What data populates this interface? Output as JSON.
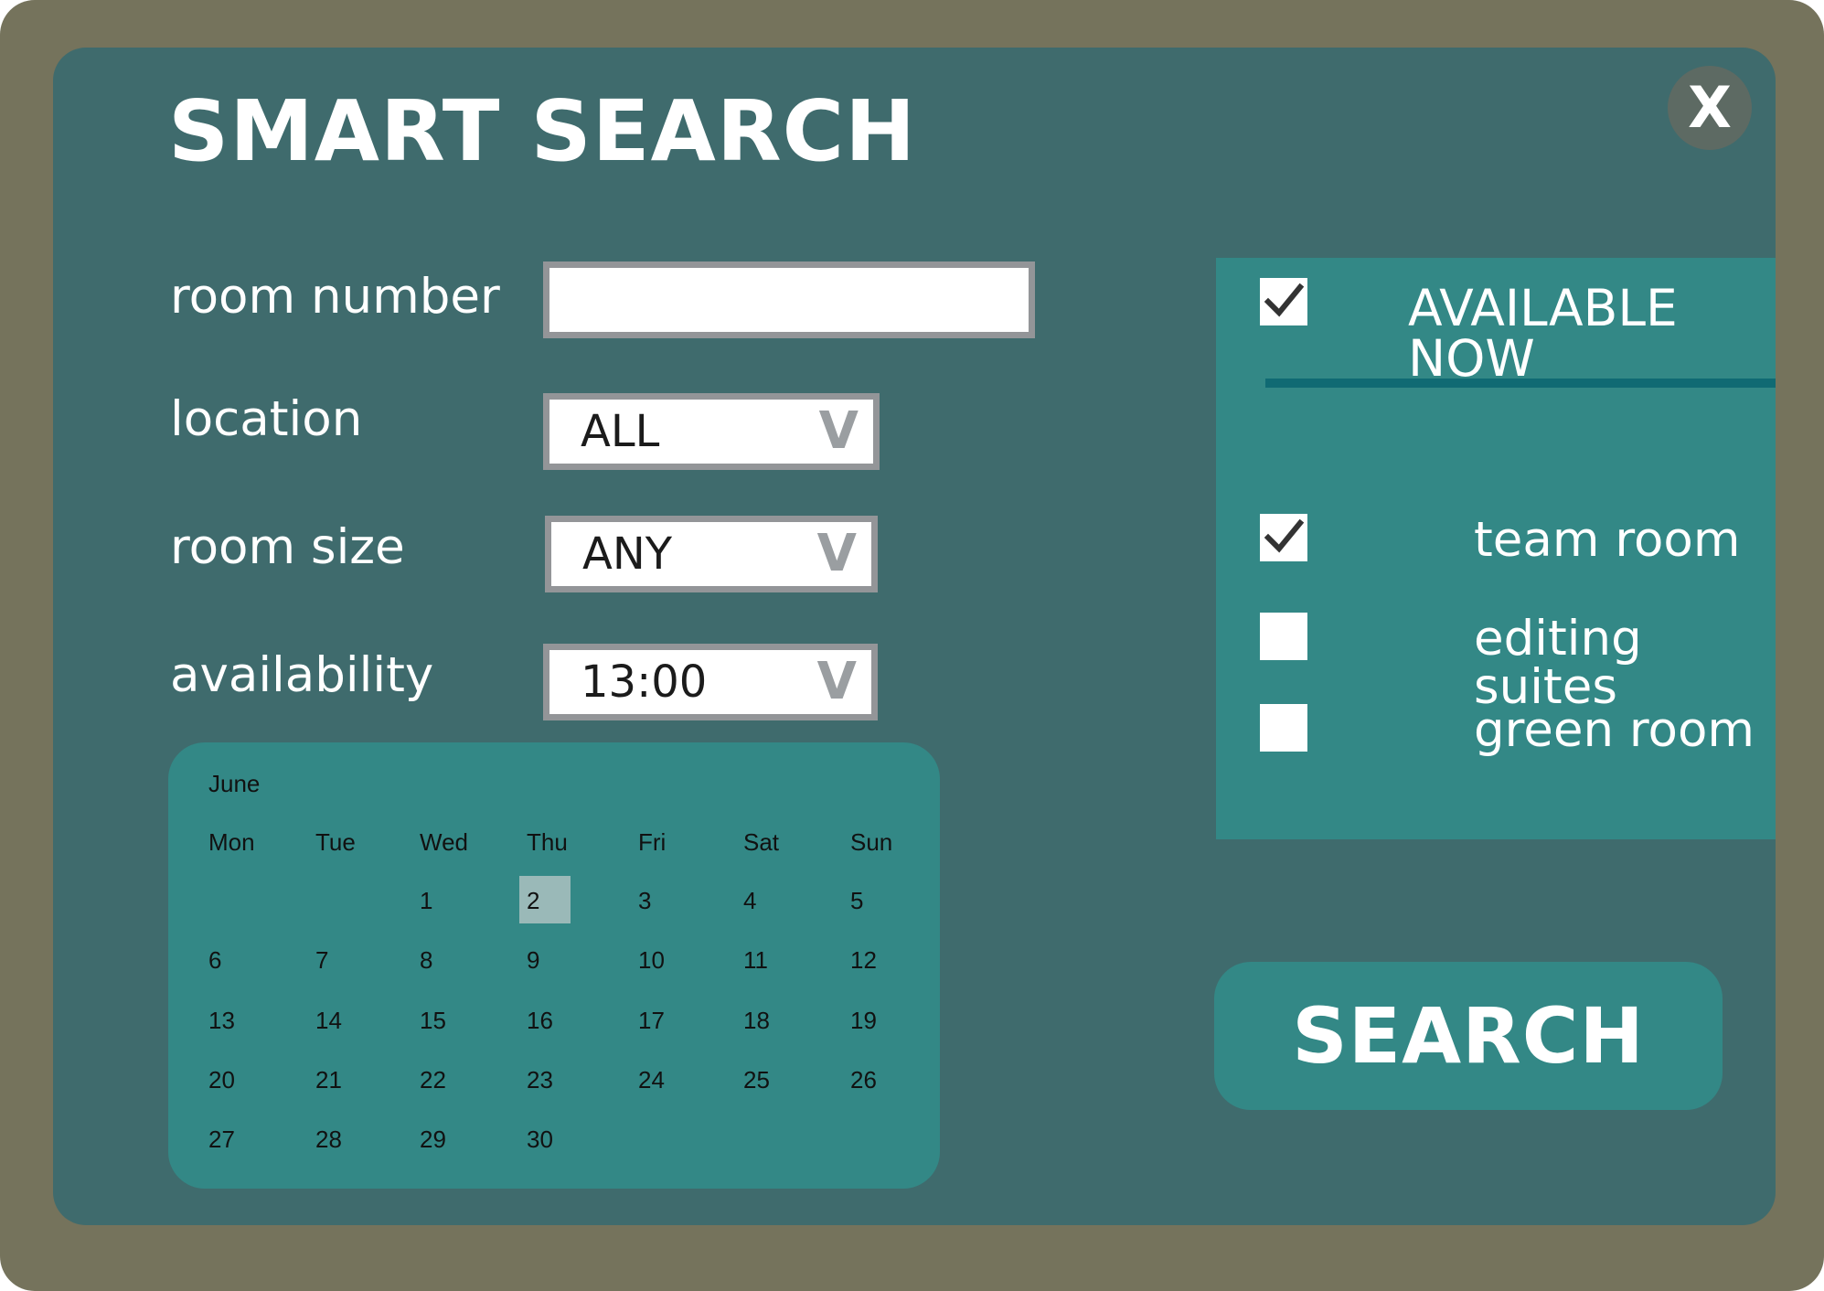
{
  "header": {
    "title": "SMART SEARCH",
    "close_label": "X"
  },
  "form": {
    "room_number": {
      "label": "room number",
      "value": ""
    },
    "location": {
      "label": "location",
      "value": "ALL",
      "chevron": "V"
    },
    "room_size": {
      "label": "room size",
      "value": "ANY",
      "chevron": "V"
    },
    "availability": {
      "label": "availability",
      "value": "13:00",
      "chevron": "V"
    }
  },
  "calendar": {
    "month": "June",
    "weekdays": [
      "Mon",
      "Tue",
      "Wed",
      "Thu",
      "Fri",
      "Sat",
      "Sun"
    ],
    "first_weekday_index": 2,
    "days_in_month": 30,
    "selected_day": 2
  },
  "filters": {
    "available_now": {
      "label": "AVAILABLE NOW",
      "checked": true
    },
    "options": [
      {
        "label": "team room",
        "checked": true
      },
      {
        "label": "editing suites",
        "checked": false
      },
      {
        "label": "green room",
        "checked": false
      }
    ]
  },
  "search_button": {
    "label": "SEARCH"
  },
  "colors": {
    "frame": "#75735c",
    "panel": "#3f6b6d",
    "accent": "#338886",
    "input_border": "#939598",
    "selected_day": "#9ab9b8"
  },
  "icons": {
    "check": "checkmark-icon",
    "close": "close-icon",
    "chevron": "chevron-down-icon"
  }
}
